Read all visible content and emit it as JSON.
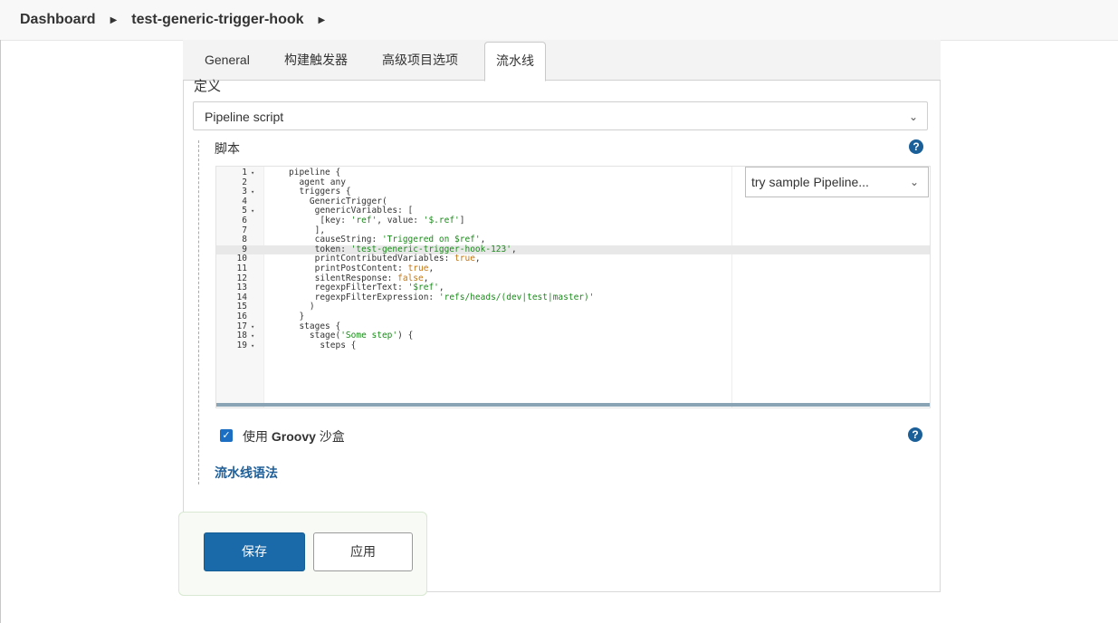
{
  "breadcrumb": {
    "items": [
      "Dashboard",
      "test-generic-trigger-hook"
    ]
  },
  "tabs": [
    "General",
    "构建触发器",
    "高级项目选项",
    "流水线"
  ],
  "definition": {
    "label": "定义",
    "selected": "Pipeline script"
  },
  "script": {
    "label": "脚本",
    "sample_select": "try sample Pipeline...",
    "lines": [
      {
        "n": "1",
        "fold": "▾",
        "text": "pipeline {"
      },
      {
        "n": "2",
        "fold": "",
        "text": "  agent any"
      },
      {
        "n": "3",
        "fold": "▾",
        "text": "  triggers {"
      },
      {
        "n": "4",
        "fold": "",
        "text": "    GenericTrigger("
      },
      {
        "n": "5",
        "fold": "▾",
        "text": "     genericVariables: ["
      },
      {
        "n": "6",
        "fold": "",
        "text": "      [key: 'ref', value: '$.ref']"
      },
      {
        "n": "7",
        "fold": "",
        "text": "     ],"
      },
      {
        "n": "8",
        "fold": "",
        "text": "     causeString: 'Triggered on $ref',"
      },
      {
        "n": "9",
        "fold": "",
        "text": "     token: 'test-generic-trigger-hook-123',"
      },
      {
        "n": "10",
        "fold": "",
        "text": "     printContributedVariables: true,"
      },
      {
        "n": "11",
        "fold": "",
        "text": "     printPostContent: true,"
      },
      {
        "n": "12",
        "fold": "",
        "text": "     silentResponse: false,"
      },
      {
        "n": "13",
        "fold": "",
        "text": "     regexpFilterText: '$ref',"
      },
      {
        "n": "14",
        "fold": "",
        "text": "     regexpFilterExpression: 'refs/heads/(dev|test|master)'"
      },
      {
        "n": "15",
        "fold": "",
        "text": "    )"
      },
      {
        "n": "16",
        "fold": "",
        "text": "  }"
      },
      {
        "n": "17",
        "fold": "▾",
        "text": "  stages {"
      },
      {
        "n": "18",
        "fold": "▾",
        "text": "    stage('Some step') {"
      },
      {
        "n": "19",
        "fold": "▾",
        "text": "      steps {"
      }
    ],
    "highlighted_line": "9"
  },
  "groovy_sandbox": {
    "prefix": "使用 ",
    "bold": "Groovy",
    "suffix": " 沙盒",
    "checked": true
  },
  "syntax_link": "流水线语法",
  "buttons": {
    "save": "保存",
    "apply": "应用"
  },
  "colors": {
    "primary": "#1a69a8",
    "link": "#1f5f99",
    "string": "#1a8a1a",
    "keyword_bool": "#c27614"
  }
}
